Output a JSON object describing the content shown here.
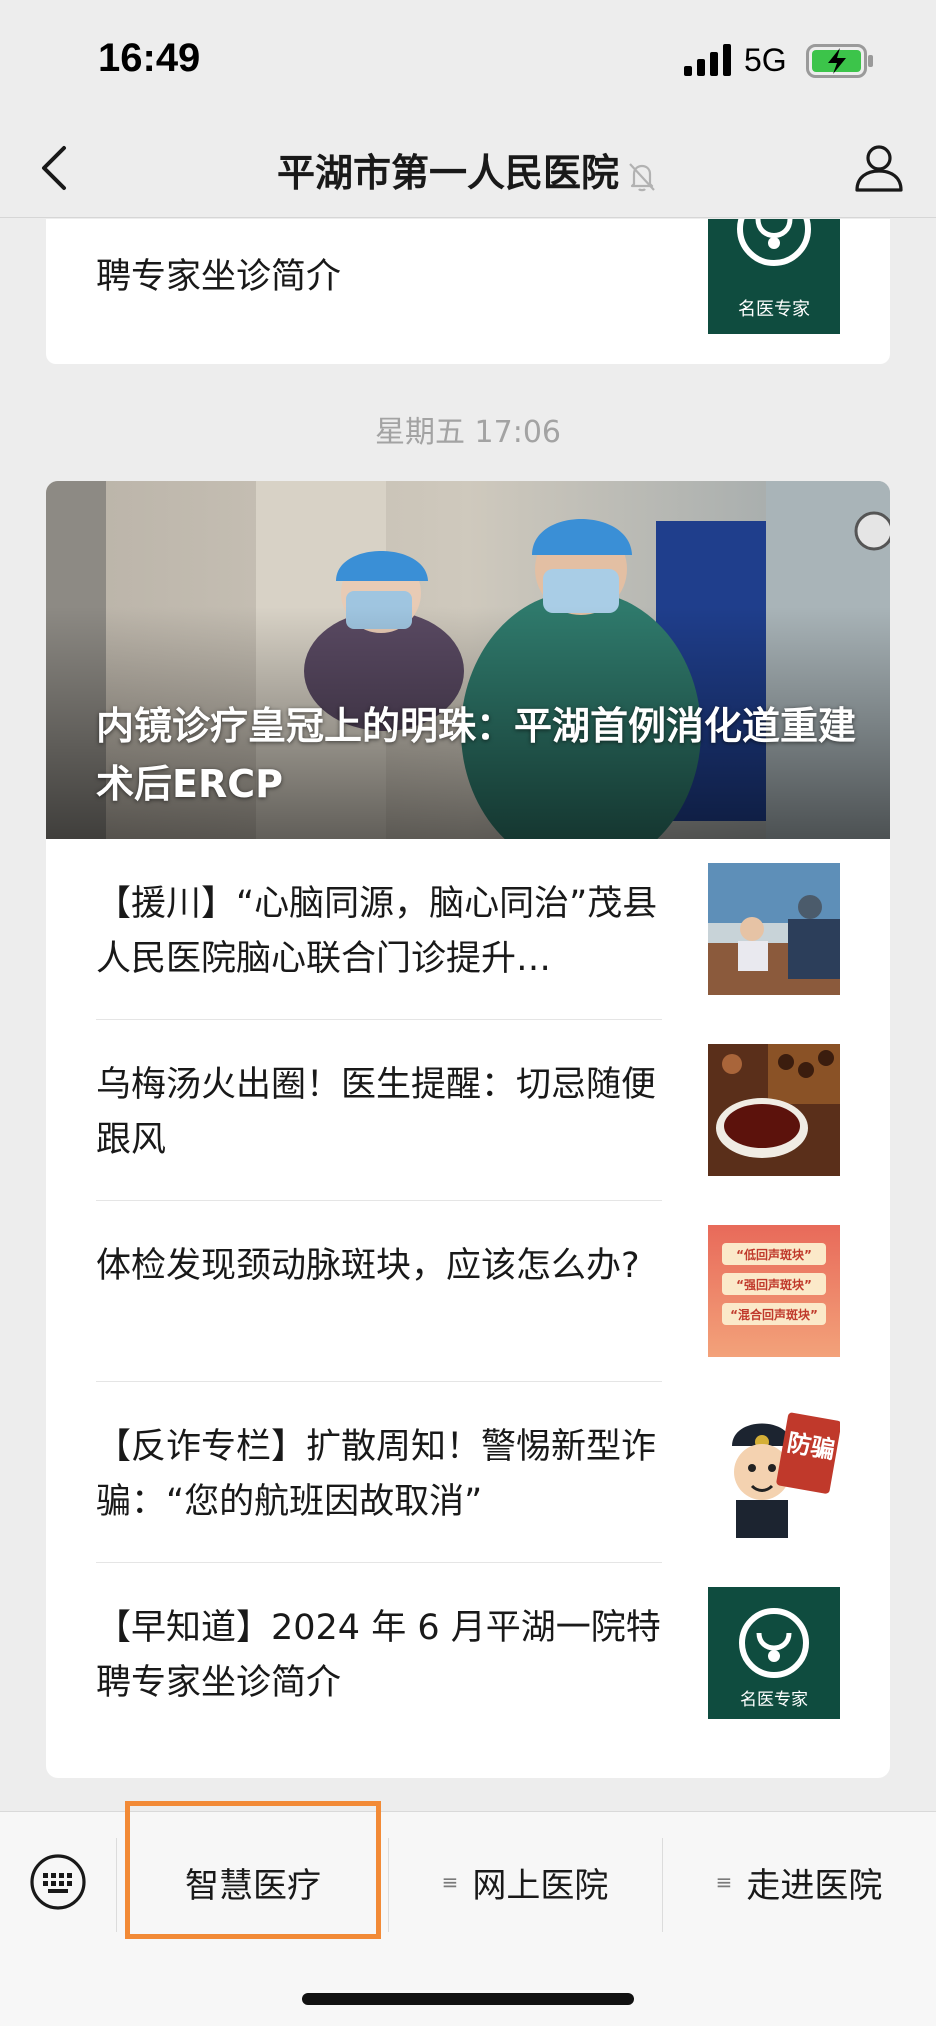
{
  "status_bar": {
    "time": "16:49",
    "network": "5G"
  },
  "nav": {
    "title": "平湖市第一人民医院"
  },
  "top_article": {
    "title": "聘专家坐诊简介",
    "thumb_text": "名医专家"
  },
  "timestamp": "星期五 17:06",
  "hero": {
    "title": "内镜诊疗皇冠上的明珠：平湖首例消化道重建术后ERCP"
  },
  "articles": [
    {
      "title": "【援川】“心脑同源，脑心同治”茂县人民医院脑心联合门诊提升…"
    },
    {
      "title": "乌梅汤火出圈！医生提醒：切忌随便跟风"
    },
    {
      "title": "体检发现颈动脉斑块，应该怎么办?",
      "thumb_lines": [
        "“低回声斑块”",
        "“强回声斑块”",
        "“混合回声斑块”"
      ]
    },
    {
      "title": "【反诈专栏】扩散周知！警惕新型诈骗：“您的航班因故取消”",
      "thumb_text": "防骗"
    },
    {
      "title": "【早知道】2024 年 6 月平湖一院特聘专家坐诊简介",
      "thumb_text": "名医专家"
    }
  ],
  "bottom_menu": {
    "items": [
      {
        "label": "智慧医疗"
      },
      {
        "label": "网上医院"
      },
      {
        "label": "走进医院"
      }
    ]
  },
  "colors": {
    "background": "#ededed",
    "highlight": "#f28a36",
    "menu_bg": "#f7f7f7",
    "thumb_green": "#0f4c3f"
  }
}
